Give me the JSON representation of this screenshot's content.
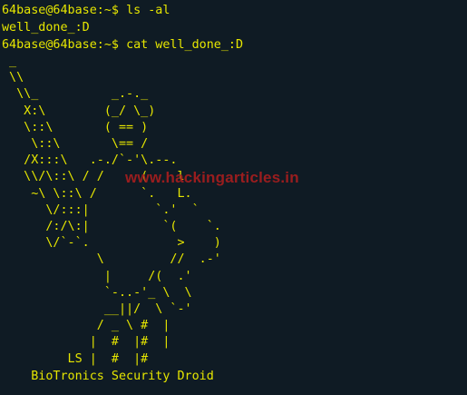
{
  "terminal": {
    "lines": [
      {
        "prompt": "64base@64base:~$ ",
        "command": "ls -al"
      },
      {
        "output": "well_done_:D"
      },
      {
        "prompt": "64base@64base:~$ ",
        "command": "cat well_done_:D"
      }
    ],
    "ascii_art": " _\n \\\\\n  \\\\_          _.-._\n   X:\\        (_/ \\_)\n   \\::\\       ( == )\n    \\::\\       \\== /\n   /X:::\\   .-./`-'\\.--.\n   \\\\/\\::\\ / /     (    l\n    ~\\ \\::\\ /      `.   L.\n      \\/:::|         `.'  `\n      /:/\\:|          `(    `.\n      \\/`-`.            >    )\n             \\         //  .-'\n              |     /(  .'\n              `-..-'_ \\  \\\n              __||/  \\ `-'\n             / _ \\ #  |\n            |  #  |#  |\n         LS |  #  |#",
    "caption": "    BioTronics Security Droid",
    "watermark": "www.hackingarticles.in"
  },
  "colors": {
    "background": "#0f1b24",
    "text": "#e6e600",
    "watermark": "#b21e1e"
  }
}
